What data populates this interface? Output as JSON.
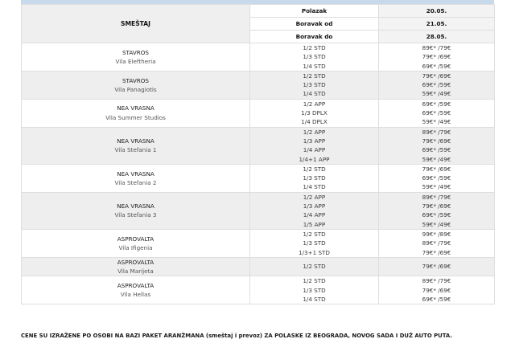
{
  "header": {
    "accommodation_label": "SMEŠTAJ",
    "rows": [
      {
        "label": "Polazak",
        "date": "20.05."
      },
      {
        "label": "Boravak od",
        "date": "21.05."
      },
      {
        "label": "Boravak do",
        "date": "28.05."
      }
    ]
  },
  "accommodations": [
    {
      "place": "STAVROS",
      "vila": "Vila Eleftheria",
      "rooms": [
        "1/2 STD",
        "1/3 STD",
        "1/4 STD"
      ],
      "prices": [
        "89€* /79€",
        "79€* /69€",
        "69€* /59€"
      ]
    },
    {
      "place": "STAVROS",
      "vila": "Vila Panagiotis",
      "rooms": [
        "1/2 STD",
        "1/3 STD",
        "1/4 STD"
      ],
      "prices": [
        "79€* /69€",
        "69€* /59€",
        "59€* /49€"
      ]
    },
    {
      "place": "NEA VRASNA",
      "vila": "Vila Summer Studios",
      "rooms": [
        "1/2 APP",
        "1/3 DPLX",
        "1/4 DPLX"
      ],
      "prices": [
        "69€* /59€",
        "69€* /59€",
        "59€* /49€"
      ]
    },
    {
      "place": "NEA VRASNA",
      "vila": "Vila Stefania 1",
      "rooms": [
        "1/2 APP",
        "1/3 APP",
        "1/4 APP",
        "1/4+1 APP"
      ],
      "prices": [
        "89€* /79€",
        "79€* /69€",
        "69€* /59€",
        "59€* /49€"
      ]
    },
    {
      "place": "NEA VRASNA",
      "vila": "Vila Stefania 2",
      "rooms": [
        "1/2 STD",
        "1/3 STD",
        "1/4 STD"
      ],
      "prices": [
        "79€* /69€",
        "69€* /59€",
        "59€* /49€"
      ]
    },
    {
      "place": "NEA VRASNA",
      "vila": "Vila Stefania 3",
      "rooms": [
        "1/2 APP",
        "1/3 APP",
        "1/4 APP",
        "1/5 APP"
      ],
      "prices": [
        "89€* /79€",
        "79€* /69€",
        "69€* /59€",
        "59€* /49€"
      ]
    },
    {
      "place": "ASPROVALTA",
      "vila": "Vila Ifigenia",
      "rooms": [
        "1/2 STD",
        "1/3 STD",
        "1/3+1 STD"
      ],
      "prices": [
        "99€* /89€",
        "89€* /79€",
        "79€* /69€"
      ]
    },
    {
      "place": "ASPROVALTA",
      "vila": "Vila Marijeta",
      "rooms": [
        "1/2 STD"
      ],
      "prices": [
        "79€* /69€"
      ]
    },
    {
      "place": "ASPROVALTA",
      "vila": "Vila Hellas",
      "rooms": [
        "1/2 STD",
        "1/3 STD",
        "1/4 STD"
      ],
      "prices": [
        "89€* /79€",
        "79€* /69€",
        "69€* /59€"
      ]
    }
  ],
  "footer": "CENE SU IZRAŽENE PO OSOBI NA BAZI PAKET ARANŽMANA (smeštaj i prevoz) ZA POLASKE IZ BEOGRADA, NOVOG SADA I DUŽ AUTO PUTA."
}
